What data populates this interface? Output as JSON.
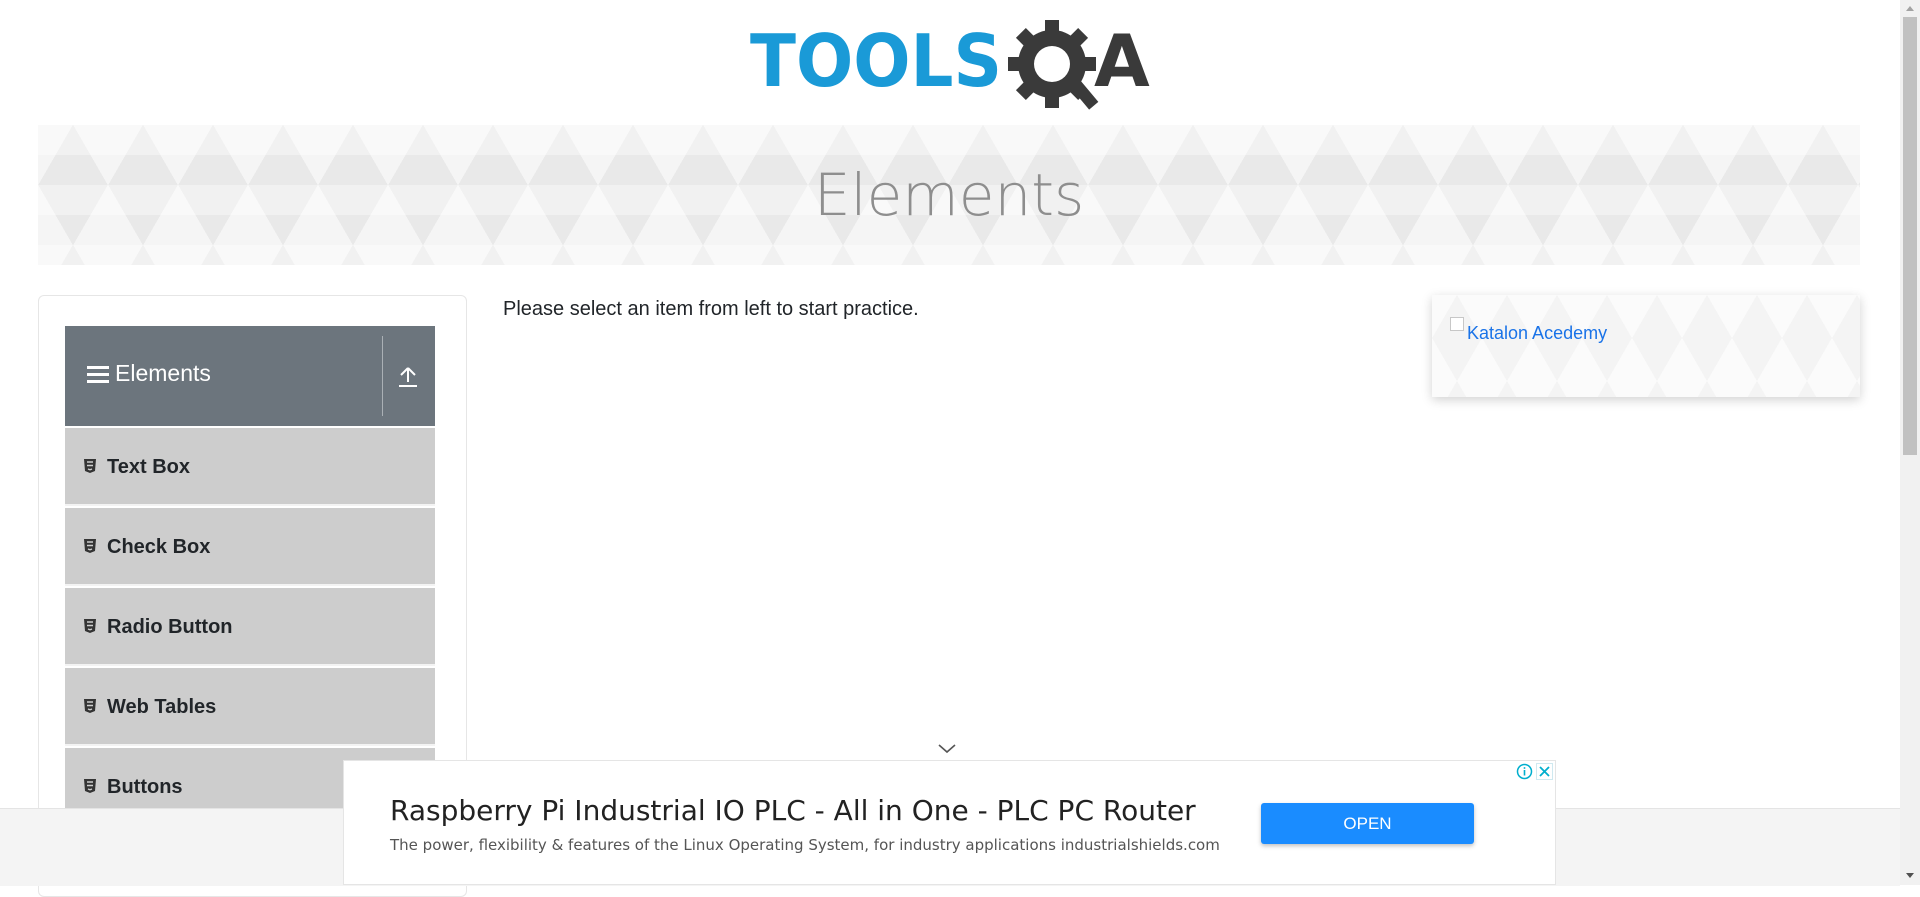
{
  "logo": {
    "text_left": "TOOLS",
    "text_right": "A",
    "icon": "gear-magnifier-icon"
  },
  "banner": {
    "title": "Elements"
  },
  "sidebar": {
    "group_title": "Elements",
    "group_icon": "hamburger-menu-icon",
    "collapse_icon": "upload-arrow-icon",
    "items": [
      {
        "label": "Text Box",
        "icon": "html5-icon"
      },
      {
        "label": "Check Box",
        "icon": "html5-icon"
      },
      {
        "label": "Radio Button",
        "icon": "html5-icon"
      },
      {
        "label": "Web Tables",
        "icon": "html5-icon"
      },
      {
        "label": "Buttons",
        "icon": "html5-icon"
      }
    ]
  },
  "main": {
    "instruction": "Please select an item from left to start practice."
  },
  "side_ad": {
    "alt_text": "Katalon Acedemy"
  },
  "bottom_ad": {
    "headline": "Raspberry Pi Industrial IO PLC - All in One - PLC PC Router",
    "description": "The power, flexibility & features of the Linux Operating System, for industry applications industrialshields.com",
    "button_label": "OPEN",
    "button_color": "#1a8cff"
  },
  "colors": {
    "brand_blue": "#1a9ad7",
    "brand_dark": "#3a3a3a",
    "sidebar_header": "#6c757d",
    "menu_item_bg": "#cdcdcd"
  }
}
